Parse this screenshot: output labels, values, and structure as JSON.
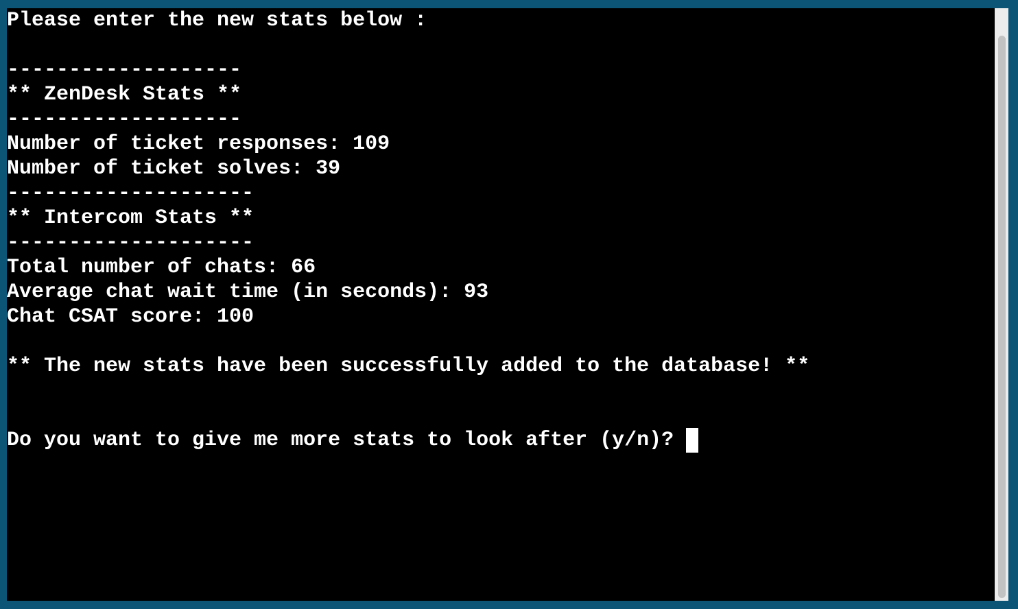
{
  "terminal": {
    "lines": [
      "Please enter the new stats below :",
      "",
      "-------------------",
      "** ZenDesk Stats **",
      "-------------------",
      "Number of ticket responses: 109",
      "Number of ticket solves: 39",
      "--------------------",
      "** Intercom Stats **",
      "--------------------",
      "Total number of chats: 66",
      "Average chat wait time (in seconds): 93",
      "Chat CSAT score: 100",
      "",
      "** The new stats have been successfully added to the database! **",
      "",
      "",
      "Do you want to give me more stats to look after (y/n)? "
    ]
  },
  "colors": {
    "frame": "#0c5576",
    "background": "#000000",
    "text": "#ffffff",
    "scrollbar_track": "#ececec",
    "scrollbar_thumb": "#c2c2c2"
  }
}
